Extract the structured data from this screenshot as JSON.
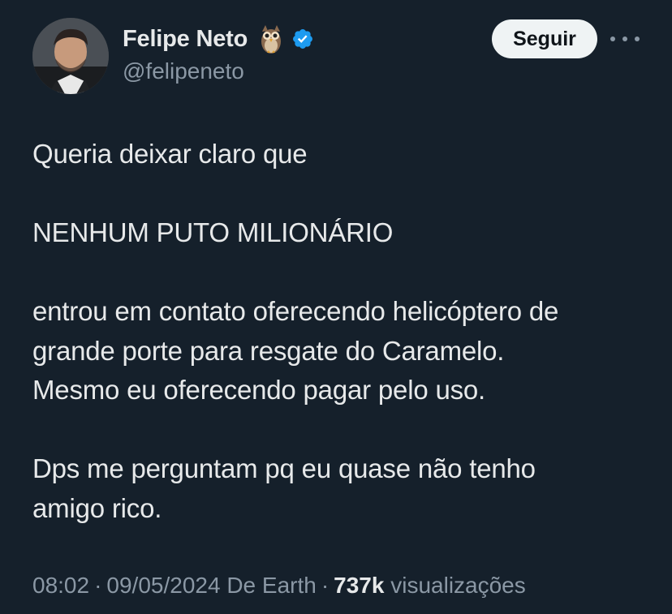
{
  "author": {
    "display_name": "Felipe Neto",
    "handle": "@felipeneto",
    "badge_emoji_icon": "owl-emoji-icon",
    "verified_icon": "verified-badge-icon",
    "verified_color": "#1d9bf0"
  },
  "actions": {
    "follow_label": "Seguir",
    "more_icon": "more-options-icon"
  },
  "tweet": {
    "lines": [
      "Queria deixar claro que",
      "",
      "NENHUM PUTO MILIONÁRIO",
      "",
      "entrou em contato oferecendo helicóptero de",
      "grande porte para resgate do Caramelo.",
      "Mesmo eu oferecendo pagar pelo uso.",
      "",
      "Dps me perguntam pq eu quase não tenho",
      "amigo rico."
    ]
  },
  "meta": {
    "time": "08:02",
    "date": "09/05/2024",
    "source": "De Earth",
    "separator": "·",
    "views_count": "737k",
    "views_label": "visualizações"
  },
  "colors": {
    "background": "#15202b",
    "text": "#e7e9ea",
    "muted": "#8b98a5",
    "button_bg": "#eff3f4"
  }
}
